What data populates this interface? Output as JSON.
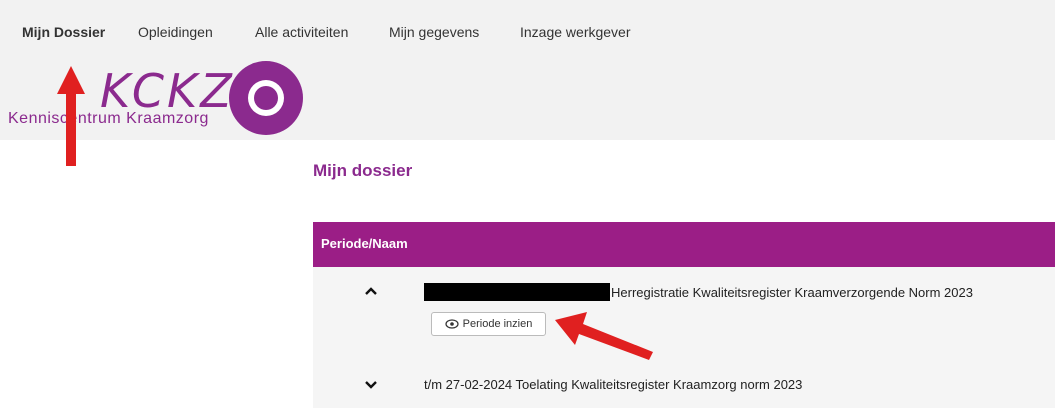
{
  "nav": {
    "items": [
      {
        "label": "Mijn Dossier"
      },
      {
        "label": "Opleidingen"
      },
      {
        "label": "Alle activiteiten"
      },
      {
        "label": "Mijn gegevens"
      },
      {
        "label": "Inzage werkgever"
      }
    ]
  },
  "logo": {
    "mark": "KCKZ",
    "subtitle": "Kenniscentrum Kraamzorg",
    "color": "#8b2a8e"
  },
  "page": {
    "title": "Mijn dossier"
  },
  "table": {
    "header": "Periode/Naam",
    "header_color": "#9b1e86",
    "rows": [
      {
        "expanded": true,
        "text": "Herregistratie Kwaliteitsregister Kraamverzorgende Norm 2023",
        "button": "Periode inzien",
        "icon": "chevron-up-icon"
      },
      {
        "expanded": false,
        "text": "t/m 27-02-2024 Toelating Kwaliteitsregister Kraamzorg norm 2023",
        "icon": "chevron-down-icon"
      }
    ]
  },
  "annotations": {
    "arrow_color": "#e02020"
  }
}
